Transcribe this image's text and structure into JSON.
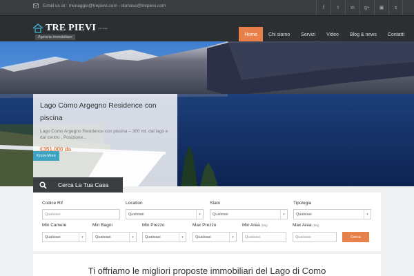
{
  "topbar": {
    "email_text": "Email us at : menaggio@trepievi.com - domaso@trepievi.com",
    "socials": [
      "f",
      "t",
      "in",
      "g+",
      "▣",
      "s"
    ]
  },
  "header": {
    "logo_name": "TRE PIEVI",
    "logo_small": "real estate",
    "tagline": "Agenzia Immobiliare",
    "nav": [
      "Home",
      "Chi siamo",
      "Servizi",
      "Video",
      "Blog & news",
      "Contatti"
    ]
  },
  "hero": {
    "title": "Lago Como Argegno Residence con piscina",
    "excerpt": "Lago Como Argegno Residence con piscina –  300 mt. dal lago e dal centro , Posizione...",
    "price": "€351,000 da",
    "button": "Know More"
  },
  "search": {
    "tab_label": "Cerca La Tua Casa",
    "codice_label": "Codice Rif",
    "codice_placeholder": "Qualsiasi",
    "location_label": "Location",
    "location_value": "Qualsiasi",
    "stato_label": "Stato",
    "stato_value": "Qualsiasi",
    "tipologia_label": "Tipologia",
    "tipologia_value": "Qualsiasi",
    "min_camere_label": "Min Camere",
    "min_camere_value": "Qualsiasi",
    "min_bagni_label": "Min Bagni",
    "min_bagni_value": "Qualsiasi",
    "min_prezzo_label": "Min Prezzo",
    "min_prezzo_value": "Qualsiasi",
    "max_prezzo_label": "Max Prezzo",
    "max_prezzo_value": "Qualsiasi",
    "min_area_label": "Min Area",
    "min_area_unit": "(Mq)",
    "min_area_placeholder": "Qualsiasi",
    "max_area_label": "Max Area",
    "max_area_unit": "(Mq)",
    "max_area_placeholder": "Qualsiasi",
    "submit": "Cerca"
  },
  "intro": {
    "heading": "Ti offriamo le migliori proposte immobiliari del Lago di Como"
  },
  "colors": {
    "accent": "#e8804a",
    "dark": "#2c2f31",
    "button_blue": "#3fa4c4"
  }
}
